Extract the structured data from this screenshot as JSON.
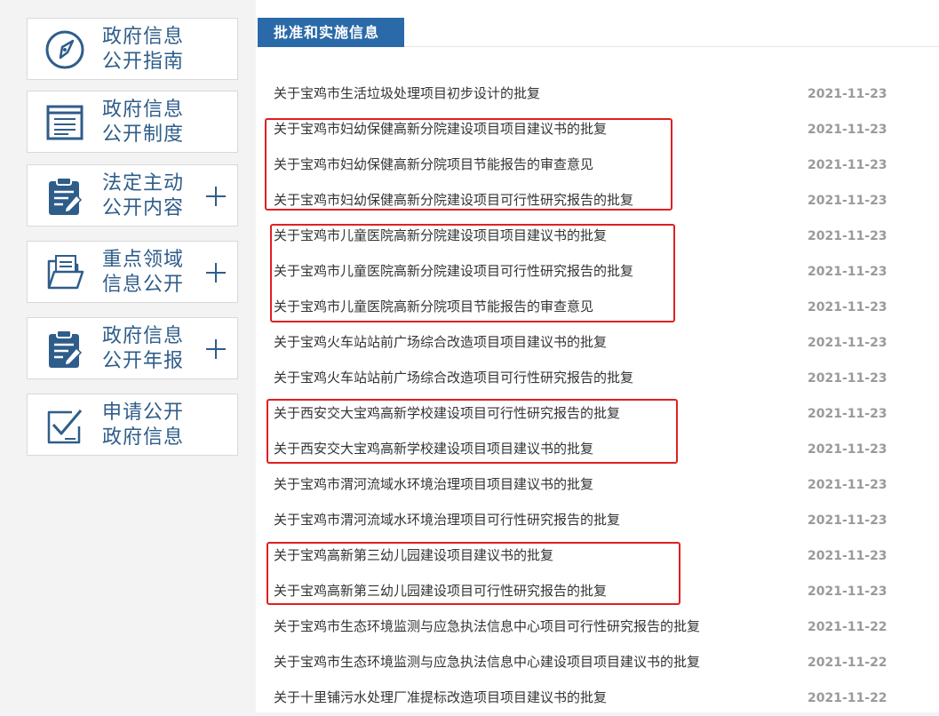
{
  "sidebar": {
    "items": [
      {
        "line1": "政府信息",
        "line2": "公开指南",
        "icon": "compass-icon",
        "expandable": false
      },
      {
        "line1": "政府信息",
        "line2": "公开制度",
        "icon": "document-list-icon",
        "expandable": false
      },
      {
        "line1": "法定主动",
        "line2": "公开内容",
        "icon": "clipboard-edit-icon",
        "expandable": true
      },
      {
        "line1": "重点领域",
        "line2": "信息公开",
        "icon": "folder-documents-icon",
        "expandable": true
      },
      {
        "line1": "政府信息",
        "line2": "公开年报",
        "icon": "clipboard-edit-icon",
        "expandable": true
      },
      {
        "line1": "申请公开",
        "line2": "政府信息",
        "icon": "checkbox-edit-icon",
        "expandable": false
      }
    ]
  },
  "main": {
    "tab_label": "批准和实施信息",
    "rows": [
      {
        "title": "关于宝鸡市生活垃圾处理项目初步设计的批复",
        "date": "2021-11-23"
      },
      {
        "title": "关于宝鸡市妇幼保健高新分院建设项目项目建议书的批复",
        "date": "2021-11-23"
      },
      {
        "title": "关于宝鸡市妇幼保健高新分院项目节能报告的审查意见",
        "date": "2021-11-23"
      },
      {
        "title": "关于宝鸡市妇幼保健高新分院建设项目可行性研究报告的批复",
        "date": "2021-11-23"
      },
      {
        "title": "关于宝鸡市儿童医院高新分院建设项目项目建议书的批复",
        "date": "2021-11-23"
      },
      {
        "title": "关于宝鸡市儿童医院高新分院建设项目可行性研究报告的批复",
        "date": "2021-11-23"
      },
      {
        "title": "关于宝鸡市儿童医院高新分院项目节能报告的审查意见",
        "date": "2021-11-23"
      },
      {
        "title": "关于宝鸡火车站站前广场综合改造项目项目建议书的批复",
        "date": "2021-11-23"
      },
      {
        "title": "关于宝鸡火车站站前广场综合改造项目可行性研究报告的批复",
        "date": "2021-11-23"
      },
      {
        "title": "关于西安交大宝鸡高新学校建设项目可行性研究报告的批复",
        "date": "2021-11-23"
      },
      {
        "title": "关于西安交大宝鸡高新学校建设项目项目建议书的批复",
        "date": "2021-11-23"
      },
      {
        "title": "关于宝鸡市渭河流域水环境治理项目项目建议书的批复",
        "date": "2021-11-23"
      },
      {
        "title": "关于宝鸡市渭河流域水环境治理项目可行性研究报告的批复",
        "date": "2021-11-23"
      },
      {
        "title": "关于宝鸡高新第三幼儿园建设项目建议书的批复",
        "date": "2021-11-23"
      },
      {
        "title": "关于宝鸡高新第三幼儿园建设项目可行性研究报告的批复",
        "date": "2021-11-23"
      },
      {
        "title": "关于宝鸡市生态环境监测与应急执法信息中心项目可行性研究报告的批复",
        "date": "2021-11-22"
      },
      {
        "title": "关于宝鸡市生态环境监测与应急执法信息中心建设项目项目建议书的批复",
        "date": "2021-11-22"
      },
      {
        "title": "关于十里铺污水处理厂准提标改造项目项目建议书的批复",
        "date": "2021-11-22"
      }
    ]
  },
  "colors": {
    "accent": "#2a6aa8",
    "icon": "#2f5d8a",
    "highlight": "#e02020",
    "date": "#9a9a9a"
  }
}
